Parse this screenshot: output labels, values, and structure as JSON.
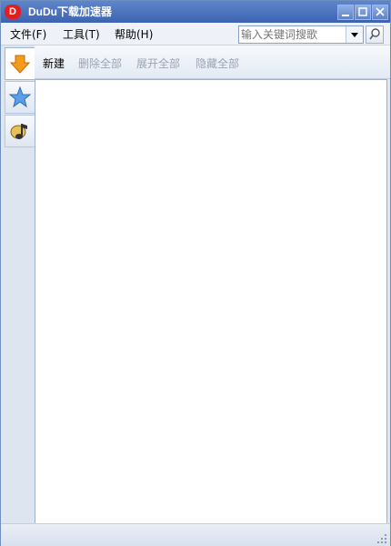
{
  "window": {
    "title": "DuDu下载加速器",
    "logo_text": "D"
  },
  "menu": [
    {
      "label": "文件(F)"
    },
    {
      "label": "工具(T)"
    },
    {
      "label": "帮助(H)"
    }
  ],
  "search": {
    "placeholder": "输入关键词搜歌"
  },
  "toolbar": {
    "new_label": "新建",
    "delete_all_label": "删除全部",
    "expand_all_label": "展开全部",
    "hide_all_label": "隐藏全部"
  },
  "sidebar": {
    "tabs": [
      {
        "icon": "download-arrow-icon"
      },
      {
        "icon": "star-icon"
      },
      {
        "icon": "music-note-icon"
      }
    ]
  },
  "colors": {
    "titlebar": "#3c63b0",
    "download_orange": "#f59b1c",
    "star_blue": "#5aa0e6",
    "disabled_text": "#9aa4b3"
  }
}
